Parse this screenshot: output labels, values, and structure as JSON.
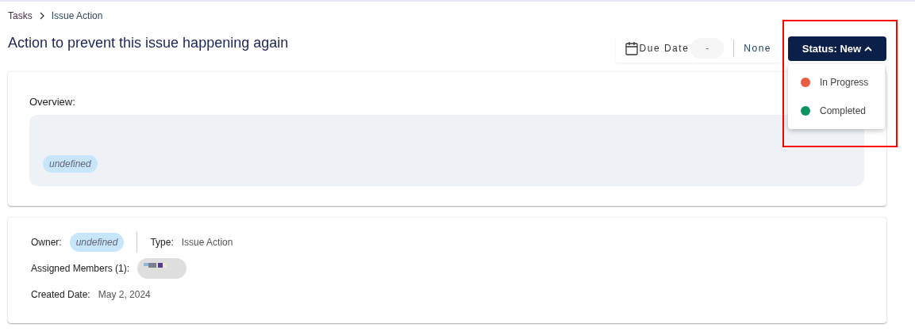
{
  "breadcrumb": [
    {
      "label": "Tasks"
    },
    {
      "label": "Issue Action"
    }
  ],
  "title": "Action to prevent this issue happening again",
  "due_date": {
    "label": "Due Date",
    "value": "-",
    "priority": "None"
  },
  "status": {
    "label": "Status: New",
    "expanded": true,
    "options": [
      {
        "label": "In Progress",
        "color": "#e85d3f"
      },
      {
        "label": "Completed",
        "color": "#0b9460"
      }
    ]
  },
  "overview": {
    "label": "Overview:",
    "tag": "undefined"
  },
  "details": {
    "owner_label": "Owner:",
    "owner": "undefined",
    "type_label": "Type:",
    "type": "Issue Action",
    "members_label": "Assigned Members (1):",
    "created_label": "Created Date:",
    "created": "May 2, 2024"
  }
}
